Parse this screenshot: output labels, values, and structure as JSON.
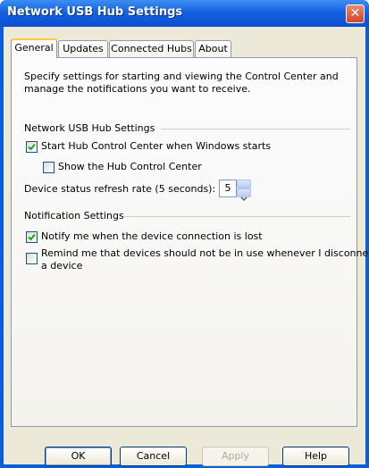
{
  "window": {
    "title": "Network USB Hub Settings"
  },
  "tabs": [
    "General",
    "Updates",
    "Connected Hubs",
    "About"
  ],
  "general": {
    "description": "Specify settings for starting and viewing the Control Center and manage the notifications you want to receive.",
    "hub_group": {
      "label": "Network USB Hub Settings",
      "start_hub": {
        "label": "Start Hub Control Center when Windows starts",
        "checked": true
      },
      "show_hub": {
        "label": "Show the Hub Control Center",
        "checked": false
      },
      "refresh": {
        "label": "Device status refresh rate (5 seconds):",
        "value": "5"
      }
    },
    "notify_group": {
      "label": "Notification Settings",
      "notify_lost": {
        "label": "Notify me when the device connection is lost",
        "checked": true
      },
      "remind": {
        "label_line1": "Remind me that devices should not be in use whenever I disconnect",
        "label_line2": "a device",
        "checked": false
      }
    }
  },
  "buttons": {
    "ok": "OK",
    "cancel": "Cancel",
    "apply": "Apply",
    "help": "Help"
  },
  "colors": {
    "titlebar": "#0b4fd0",
    "dialog_bg": "#ece9d8",
    "active_tab_accent": "#ffc83c"
  }
}
